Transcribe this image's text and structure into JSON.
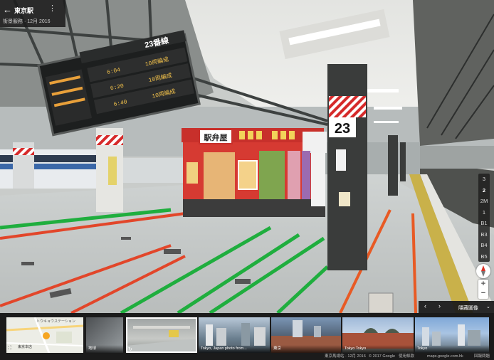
{
  "place_card": {
    "back_icon": "arrow-back-icon",
    "title": "東京駅",
    "menu_icon": "more-vert-icon",
    "date": "街景服務 · 12月 2016"
  },
  "scene": {
    "platform_sign_number": "23",
    "departure_board_track": "23番線",
    "departure_rows": [
      {
        "time": "6:04",
        "info": "10両編成"
      },
      {
        "time": "6:20",
        "info": "10両編成"
      },
      {
        "time": "6:40",
        "info": "10両編成"
      }
    ],
    "kiosk_sign": "駅弁屋"
  },
  "floor_selector": {
    "items": [
      "3",
      "2",
      "2M",
      "1",
      "B1",
      "B3",
      "B4",
      "B5"
    ],
    "active": "2"
  },
  "zoom": {
    "in": "+",
    "out": "−"
  },
  "compass_icon": "compass-icon",
  "thumb_bar": {
    "prev_icon": "chevron-left-icon",
    "next_icon": "chevron-right-icon",
    "label": "隱藏圖像",
    "collapse_icon": "chevron-down-icon"
  },
  "thumbnails": [
    {
      "kind": "map",
      "caption": "",
      "map_labels": [
        "トウキョウステーション",
        "東京本店"
      ]
    },
    {
      "kind": "photo",
      "caption": "地球"
    },
    {
      "kind": "photo",
      "caption": "",
      "selected": true
    },
    {
      "kind": "photo",
      "caption": "Tokyo, Japan photo from..."
    },
    {
      "kind": "photo",
      "caption": "東京"
    },
    {
      "kind": "photo",
      "caption": "Tokyo Tokyo"
    },
    {
      "kind": "photo",
      "caption": "Tokyo"
    }
  ],
  "footer": {
    "date": "東京馬總站 · 12月 2016",
    "copyright": "© 2017 Google",
    "terms": "使用條款",
    "url": "maps.google.com.hk",
    "report": "回報問題"
  }
}
